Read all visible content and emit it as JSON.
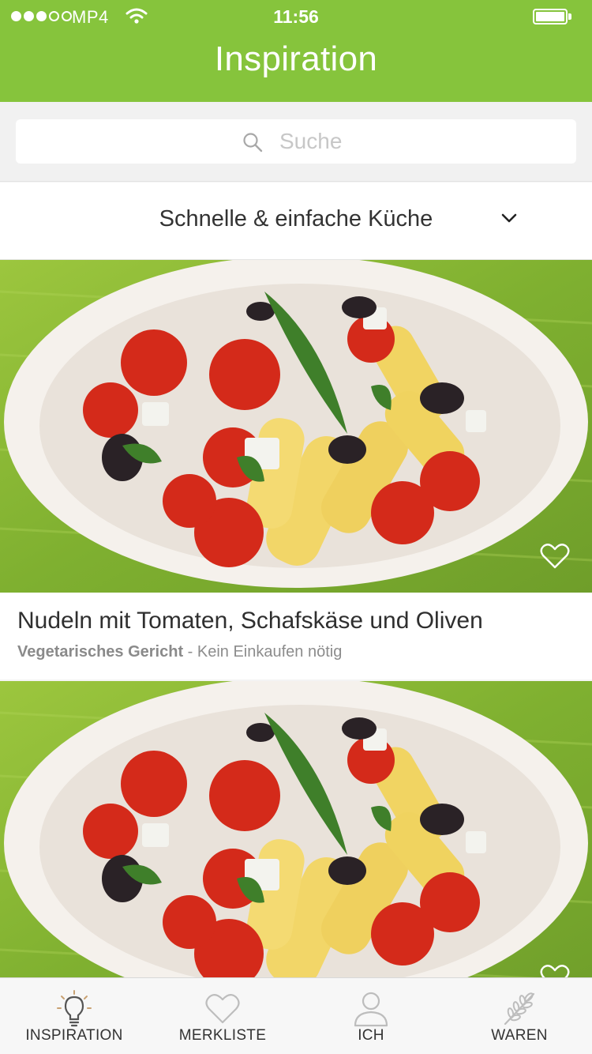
{
  "status_bar": {
    "carrier": "MP4",
    "time": "11:56"
  },
  "header": {
    "title": "Inspiration"
  },
  "search": {
    "placeholder": "Suche"
  },
  "category_selector": {
    "selected": "Schnelle & einfache Küche",
    "icon": "chevron-down-icon"
  },
  "recipes": [
    {
      "title": "Nudeln mit Tomaten, Schafskäse und Oliven",
      "category": "Vegetarisches Gericht",
      "note": " - Kein Einkaufen nötig",
      "favorite_icon": "heart-outline-icon"
    },
    {
      "title": "",
      "category": "",
      "note": "",
      "favorite_icon": "heart-outline-icon"
    }
  ],
  "tabbar": {
    "items": [
      {
        "label": "INSPIRATION",
        "icon": "lightbulb-icon",
        "active": true
      },
      {
        "label": "MERKLISTE",
        "icon": "heart-icon",
        "active": false
      },
      {
        "label": "ICH",
        "icon": "person-icon",
        "active": false
      },
      {
        "label": "WAREN",
        "icon": "wheat-icon",
        "active": false
      }
    ]
  },
  "colors": {
    "brand_green": "#86c43c",
    "text_dark": "#2f2f2f",
    "text_muted": "#8c8c8c"
  }
}
